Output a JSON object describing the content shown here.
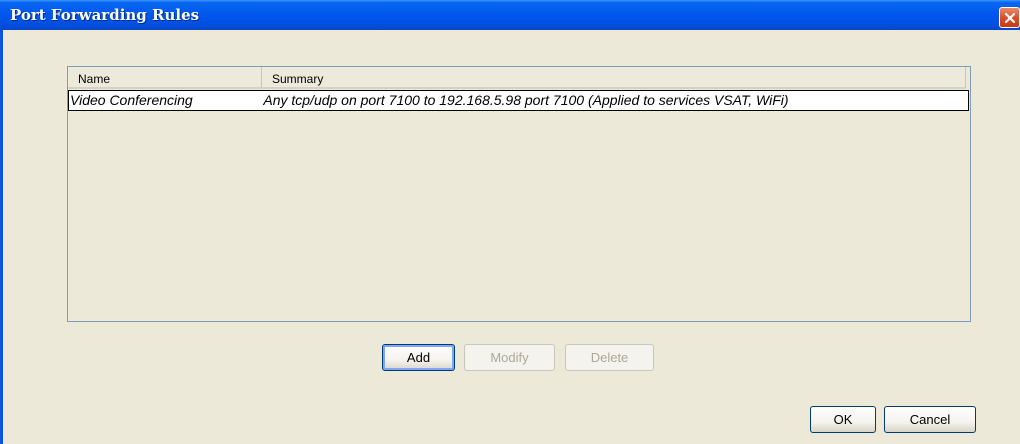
{
  "window": {
    "title": "Port Forwarding Rules"
  },
  "table": {
    "columns": [
      "Name",
      "Summary"
    ],
    "rows": [
      {
        "name": "Video Conferencing",
        "summary": "Any tcp/udp on port 7100 to 192.168.5.98 port 7100 (Applied to services VSAT, WiFi)"
      }
    ]
  },
  "actions": {
    "add_label": "Add",
    "modify_label": "Modify",
    "delete_label": "Delete"
  },
  "dialog_buttons": {
    "ok_label": "OK",
    "cancel_label": "Cancel"
  },
  "colors": {
    "titlebar": "#0058ee",
    "client_bg": "#ece9d8",
    "close_button": "#d8502a"
  },
  "icons": {
    "close": "close-icon"
  }
}
